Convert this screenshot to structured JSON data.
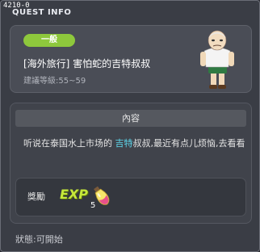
{
  "window": {
    "quest_id": "4210-0",
    "title": "QUEST INFO"
  },
  "quest": {
    "category": "一般",
    "title": "[海外旅行] 害怕蛇的吉特叔叔",
    "level_label": "建議等級:",
    "level_range": "55~59",
    "npc_icon": "npc-old-man-portrait"
  },
  "content": {
    "header": "內容",
    "text_before": "听说在泰国水上市场的 ",
    "highlight": "吉特",
    "text_after": "叔叔,最近有点儿烦恼,去看看"
  },
  "reward": {
    "label": "獎勵",
    "exp_text": "EXP",
    "item_icon": "elixir-bottle",
    "item_count": "5"
  },
  "status": {
    "label": "狀態:",
    "value": "可開始"
  },
  "colors": {
    "badge": "#8ec83c",
    "highlight": "#5ed9ee"
  }
}
